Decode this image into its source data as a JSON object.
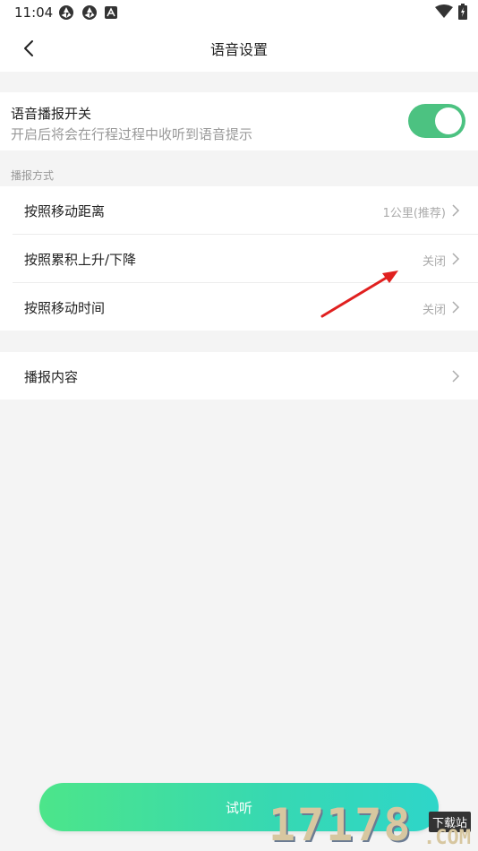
{
  "status_bar": {
    "time": "11:04"
  },
  "header": {
    "title": "语音设置"
  },
  "voice_switch": {
    "title": "语音播报开关",
    "subtitle": "开启后将会在行程过程中收听到语音提示",
    "enabled": true
  },
  "broadcast_mode": {
    "label": "播报方式",
    "items": [
      {
        "label": "按照移动距离",
        "value": "1公里(推荐)"
      },
      {
        "label": "按照累积上升/下降",
        "value": "关闭"
      },
      {
        "label": "按照移动时间",
        "value": "关闭"
      }
    ]
  },
  "broadcast_content": {
    "label": "播报内容"
  },
  "try_button": {
    "label": "试听"
  },
  "watermark": {
    "digits": "17178",
    "tag": "下载站",
    "domain": ".COM"
  },
  "colors": {
    "accent": "#4cc281",
    "button_gradient_start": "#4ce58a",
    "button_gradient_end": "#2ed6c9"
  }
}
